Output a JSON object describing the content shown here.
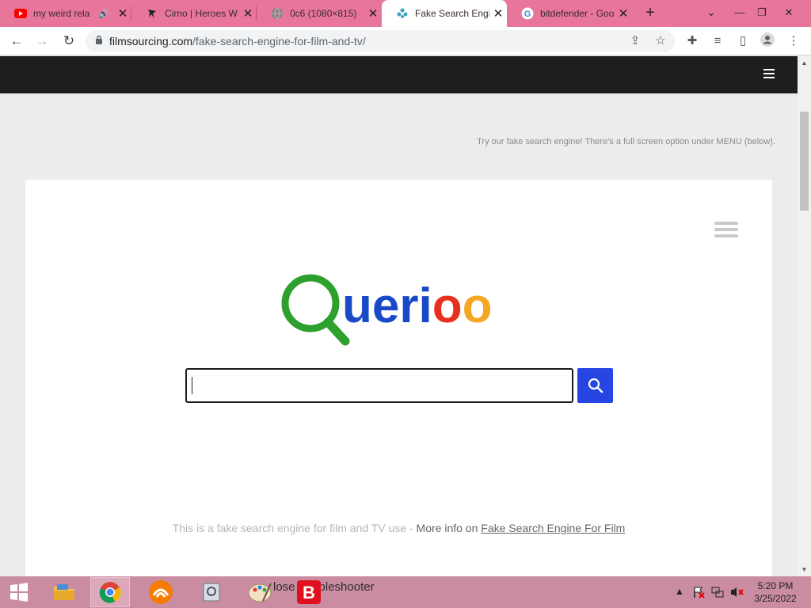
{
  "tabs": [
    {
      "title": "my weird rela",
      "icon": "youtube-icon"
    },
    {
      "title": "Cirno | Heroes W",
      "icon": "dancer-icon"
    },
    {
      "title": "0c6 (1080×815)",
      "icon": "globe-icon"
    },
    {
      "title": "Fake Search Engin",
      "icon": "querioo-flower-icon"
    },
    {
      "title": "bitdefender - Goo",
      "icon": "google-icon"
    }
  ],
  "address": {
    "domain": "filmsourcing.com",
    "path": "/fake-search-engine-for-film-and-tv/"
  },
  "page": {
    "hint": "Try our fake search engine! There's a full screen option under MENU (below).",
    "logo_text": "uerioo",
    "search_value": "",
    "footer_static": "This is a fake search engine for film and TV use - ",
    "footer_more": "More info on ",
    "footer_link": "Fake Search Engine For Film"
  },
  "taskbar": {
    "window_text": "lose troubleshooter",
    "clock_time": "5:20 PM",
    "clock_date": "3/25/2022"
  },
  "colors": {
    "tabstrip": "#e8769b",
    "taskbar": "#c98ca0",
    "search_button": "#2745e3",
    "logo_green": "#2ea02e",
    "logo_blue": "#1a49c8",
    "logo_red": "#e8301f",
    "logo_orange": "#f5a623"
  }
}
